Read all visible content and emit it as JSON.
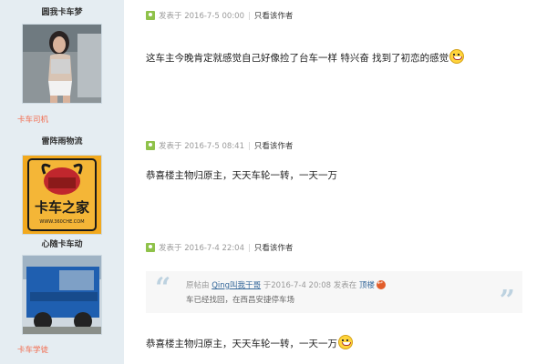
{
  "users": [
    {
      "name": "圆我卡车梦",
      "group": "卡车司机"
    },
    {
      "name": "雷阵雨物流",
      "group": "心随卡车动",
      "avatar_text": "卡车之家",
      "avatar_url": "WWW.360CHE.COM"
    },
    {
      "name": "",
      "group": "卡车学徒"
    }
  ],
  "posts": [
    {
      "meta_prefix": "发表于",
      "date": "2016-7-5 00:00",
      "view_author": "只看该作者",
      "content": "这车主今晚肯定就感觉自己好像捡了台车一样    特兴奋    找到了初恋的感觉"
    },
    {
      "meta_prefix": "发表于",
      "date": "2016-7-5 08:41",
      "view_author": "只看该作者",
      "content": "恭喜楼主物归原主，天天车轮一转，一天一万"
    },
    {
      "meta_prefix": "发表于",
      "date": "2016-7-4 22:04",
      "view_author": "只看该作者",
      "quote": {
        "origin_prefix": "原帖由",
        "author": "Qing叫我干哥",
        "at": "于2016-7-4 20:08 发表在",
        "floor": "顶楼",
        "text": "车已经找回，在西昌安捷停车场"
      },
      "content": "恭喜楼主物归原主，天天车轮一转，一天一万"
    }
  ],
  "colors": {
    "sidebar": "#e5edf2",
    "group": "#f26c4f",
    "link": "#336699",
    "meta": "#999999"
  }
}
